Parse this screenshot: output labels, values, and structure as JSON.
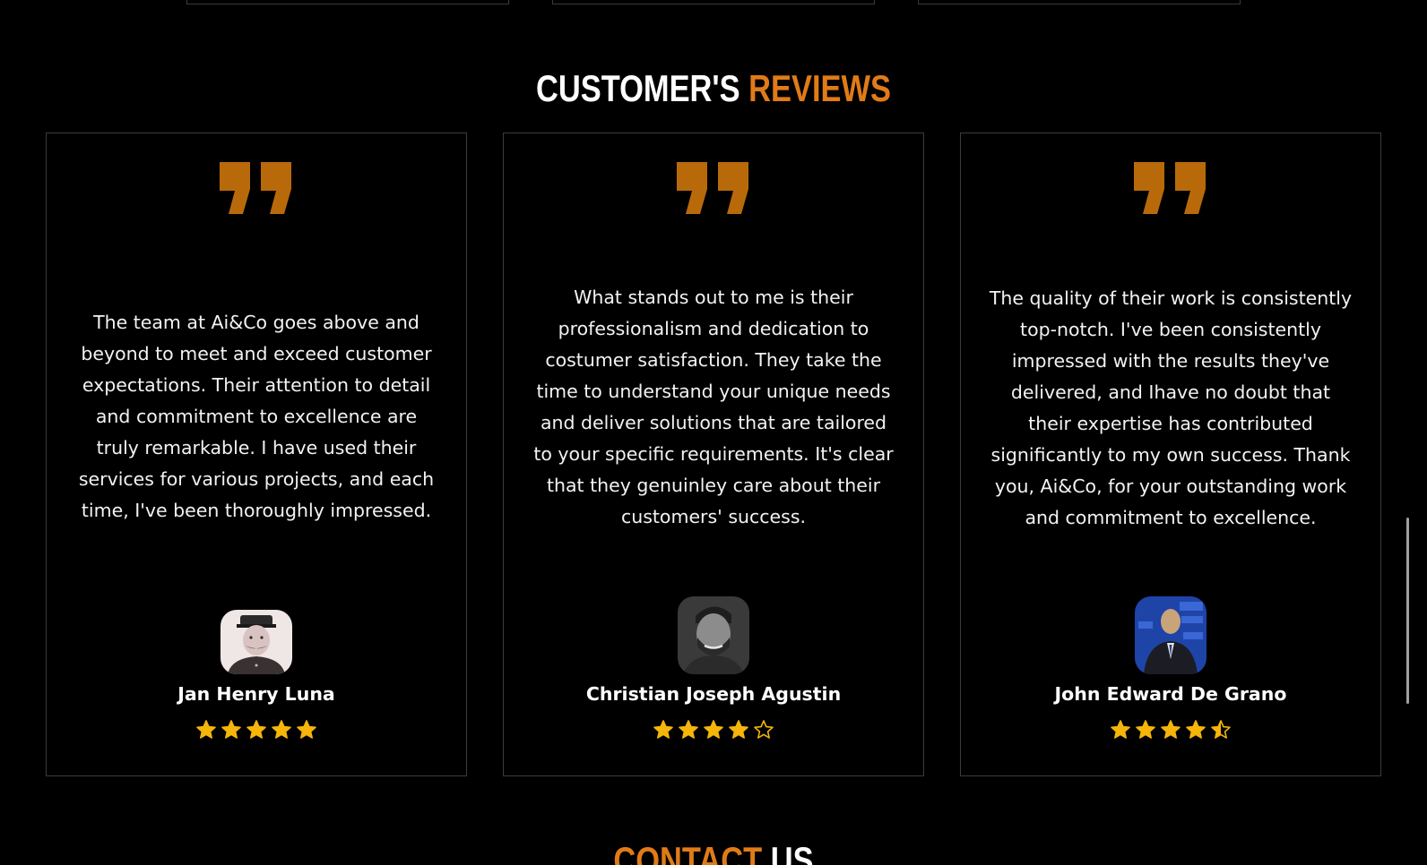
{
  "reviews_section": {
    "title_part1": "CUSTOMER'S",
    "title_part2": "REVIEWS"
  },
  "reviews": [
    {
      "text": "The team at Ai&Co goes above and beyond to meet and exceed customer expectations. Their attention to detail and commitment to excellence are truly remarkable. I have used their services for various projects, and each time, I've been thoroughly impressed.",
      "name": "Jan Henry Luna",
      "rating": 5
    },
    {
      "text": "What stands out to me is their professionalism and dedication to costumer satisfaction. They take the time to understand your unique needs and deliver solutions that are tailored to your specific requirements. It's clear that they genuinley care about their customers' success.",
      "name": "Christian Joseph Agustin",
      "rating": 4
    },
    {
      "text": "The quality of their work is consistently top-notch. I've been consistently impressed with the results they've delivered, and Ihave no doubt that their expertise has contributed significantly to my own success. Thank you, Ai&Co, for your outstanding work and commitment to excellence.",
      "name": "John Edward De Grano",
      "rating": 4.5
    }
  ],
  "contact_section": {
    "title_part1": "CONTACT",
    "title_part2": "US"
  },
  "icons": {
    "quote": "quote-icon",
    "star_full": "star-icon",
    "star_half": "star-half-icon",
    "star_empty": "star-empty-icon"
  },
  "colors": {
    "background": "#000000",
    "accent_orange": "#e07b18",
    "quote_orange": "#b86a0a",
    "star_yellow": "#f5b50a",
    "card_border": "#3c3c3c"
  }
}
